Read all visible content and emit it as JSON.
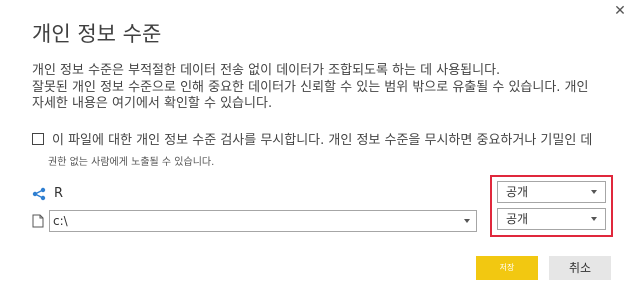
{
  "dialog": {
    "title": "개인 정보 수준",
    "close_glyph": "✕",
    "description_lines": [
      "개인 정보 수준은 부적절한 데이터 전송 없이 데이터가 조합되도록 하는 데 사용됩니다.",
      "잘못된 개인 정보 수준으로 인해 중요한 데이터가 신뢰할 수 있는 범위 밖으로 유출될 수 있습니다. 개인",
      "자세한 내용은 여기에서 확인할 수 있습니다."
    ],
    "ignore_option": {
      "checked": false,
      "label": "이 파일에 대한 개인 정보 수준 검사를 무시합니다. 개인 정보 수준을 무시하면 중요하거나 기밀인 데",
      "sublabel": "권한 없는 사람에게 노출될 수 있습니다."
    }
  },
  "sources": [
    {
      "label": "R",
      "icon": "r-source-icon",
      "privacy_level": "공개"
    },
    {
      "path_value": "c:\\",
      "icon": "file-icon",
      "privacy_level": "공개"
    }
  ],
  "buttons": {
    "save_label": "저장",
    "cancel_label": "취소"
  },
  "colors": {
    "highlight_border": "#e0283c",
    "save_button_bg": "#f2c811",
    "cancel_button_bg": "#e6e6e6",
    "source_icon": "#2f7fd1"
  }
}
